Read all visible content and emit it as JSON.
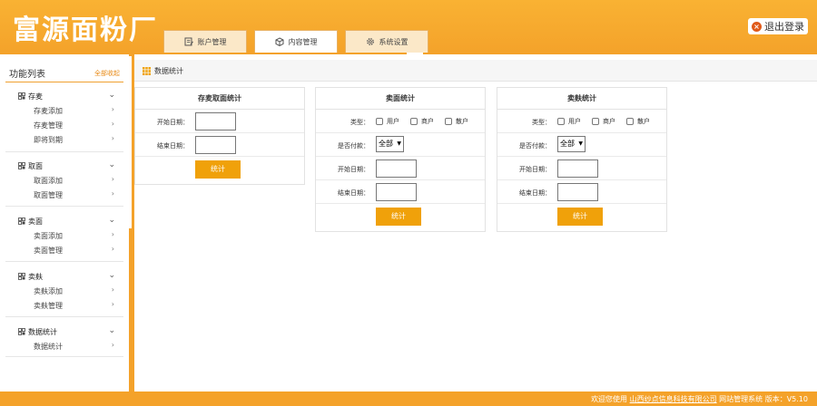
{
  "header": {
    "logo": "富源面粉厂",
    "tabs": [
      {
        "label": "账户管理",
        "icon": "ledger-icon"
      },
      {
        "label": "内容管理",
        "icon": "box-icon"
      },
      {
        "label": "系统设置",
        "icon": "gear-icon"
      }
    ],
    "logout": "退出登录"
  },
  "sidebar": {
    "title": "功能列表",
    "collapse_all": "全部收起",
    "groups": [
      {
        "label": "存麦",
        "items": [
          "存麦添加",
          "存麦管理",
          "即将到期"
        ]
      },
      {
        "label": "取面",
        "items": [
          "取面添加",
          "取面管理"
        ]
      },
      {
        "label": "卖面",
        "items": [
          "卖面添加",
          "卖面管理"
        ]
      },
      {
        "label": "卖麸",
        "items": [
          "卖麸添加",
          "卖麸管理"
        ]
      },
      {
        "label": "数据统计",
        "items": [
          "数据统计"
        ]
      }
    ]
  },
  "main": {
    "breadcrumb": "数据统计",
    "panels": [
      {
        "title": "存麦取面统计",
        "start_label": "开始日期：",
        "end_label": "结束日期：",
        "button": "统计"
      },
      {
        "title": "卖面统计",
        "type_label": "类型：",
        "type_options": [
          "用户",
          "商户",
          "散户"
        ],
        "paid_label": "是否付款：",
        "paid_value": "全部",
        "start_label": "开始日期：",
        "end_label": "结束日期：",
        "button": "统计"
      },
      {
        "title": "卖麸统计",
        "type_label": "类型：",
        "type_options": [
          "用户",
          "商户",
          "散户"
        ],
        "paid_label": "是否付款：",
        "paid_value": "全部",
        "start_label": "开始日期：",
        "end_label": "结束日期：",
        "button": "统计"
      }
    ]
  },
  "footer": {
    "welcome": "欢迎您使用",
    "company": "山西纱点信息科技有限公司",
    "system": "网站管理系统",
    "version": "版本：V5.10"
  },
  "colors": {
    "accent": "#f4a22a",
    "button": "#f0a10a"
  }
}
